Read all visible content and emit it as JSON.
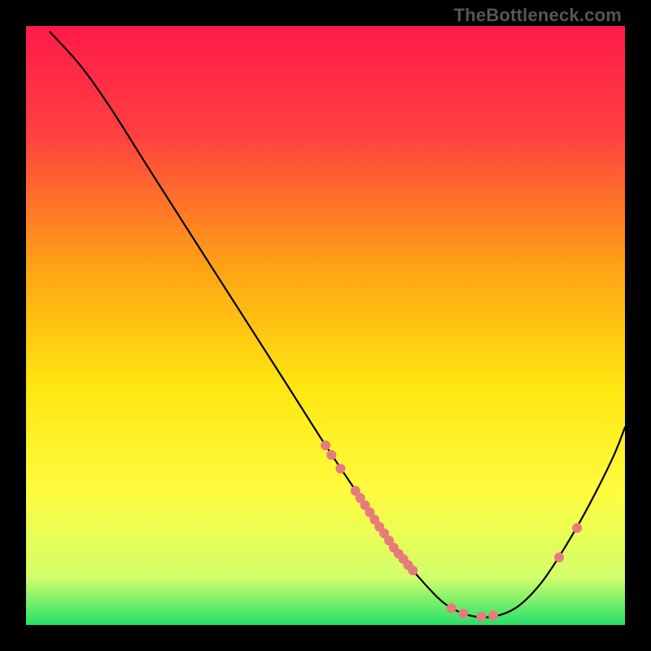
{
  "watermark": "TheBottleneck.com",
  "chart_data": {
    "type": "line",
    "title": "",
    "xlabel": "",
    "ylabel": "",
    "xlim": [
      0,
      100
    ],
    "ylim": [
      0,
      100
    ],
    "background_gradient": {
      "stops": [
        {
          "offset": 0,
          "color": "#ff1a4b"
        },
        {
          "offset": 18,
          "color": "#ff4040"
        },
        {
          "offset": 40,
          "color": "#ffa114"
        },
        {
          "offset": 60,
          "color": "#ffe610"
        },
        {
          "offset": 78,
          "color": "#fffc40"
        },
        {
          "offset": 92,
          "color": "#d2ff6b"
        },
        {
          "offset": 100,
          "color": "#26e06a"
        }
      ]
    },
    "curve": [
      {
        "x": 4.0,
        "y": 99.0
      },
      {
        "x": 9.0,
        "y": 93.5
      },
      {
        "x": 14.0,
        "y": 86.5
      },
      {
        "x": 20.0,
        "y": 77.0
      },
      {
        "x": 27.0,
        "y": 66.0
      },
      {
        "x": 35.0,
        "y": 53.5
      },
      {
        "x": 43.0,
        "y": 41.0
      },
      {
        "x": 50.0,
        "y": 30.0
      },
      {
        "x": 56.0,
        "y": 21.0
      },
      {
        "x": 61.0,
        "y": 13.5
      },
      {
        "x": 66.0,
        "y": 7.5
      },
      {
        "x": 70.0,
        "y": 3.5
      },
      {
        "x": 74.0,
        "y": 1.6
      },
      {
        "x": 78.0,
        "y": 1.4
      },
      {
        "x": 82.0,
        "y": 3.0
      },
      {
        "x": 86.0,
        "y": 7.0
      },
      {
        "x": 90.0,
        "y": 13.0
      },
      {
        "x": 94.0,
        "y": 20.0
      },
      {
        "x": 98.0,
        "y": 28.0
      },
      {
        "x": 100.0,
        "y": 33.0
      }
    ],
    "scatter": {
      "color": "#e77b7b",
      "radius": 6,
      "points": [
        {
          "x": 50.0,
          "y": 30.0
        },
        {
          "x": 51.0,
          "y": 28.4
        },
        {
          "x": 52.5,
          "y": 26.1
        },
        {
          "x": 55.0,
          "y": 22.4
        },
        {
          "x": 55.8,
          "y": 21.2
        },
        {
          "x": 56.6,
          "y": 20.0
        },
        {
          "x": 57.4,
          "y": 18.8
        },
        {
          "x": 58.2,
          "y": 17.6
        },
        {
          "x": 59.0,
          "y": 16.4
        },
        {
          "x": 59.8,
          "y": 15.3
        },
        {
          "x": 60.6,
          "y": 14.1
        },
        {
          "x": 61.4,
          "y": 12.9
        },
        {
          "x": 62.2,
          "y": 11.9
        },
        {
          "x": 63.0,
          "y": 11.0
        },
        {
          "x": 63.8,
          "y": 10.0
        },
        {
          "x": 64.6,
          "y": 9.1
        },
        {
          "x": 71.0,
          "y": 2.8
        },
        {
          "x": 73.0,
          "y": 1.9
        },
        {
          "x": 76.0,
          "y": 1.4
        },
        {
          "x": 78.0,
          "y": 1.6
        },
        {
          "x": 89.0,
          "y": 11.3
        },
        {
          "x": 92.0,
          "y": 16.2
        }
      ]
    }
  }
}
